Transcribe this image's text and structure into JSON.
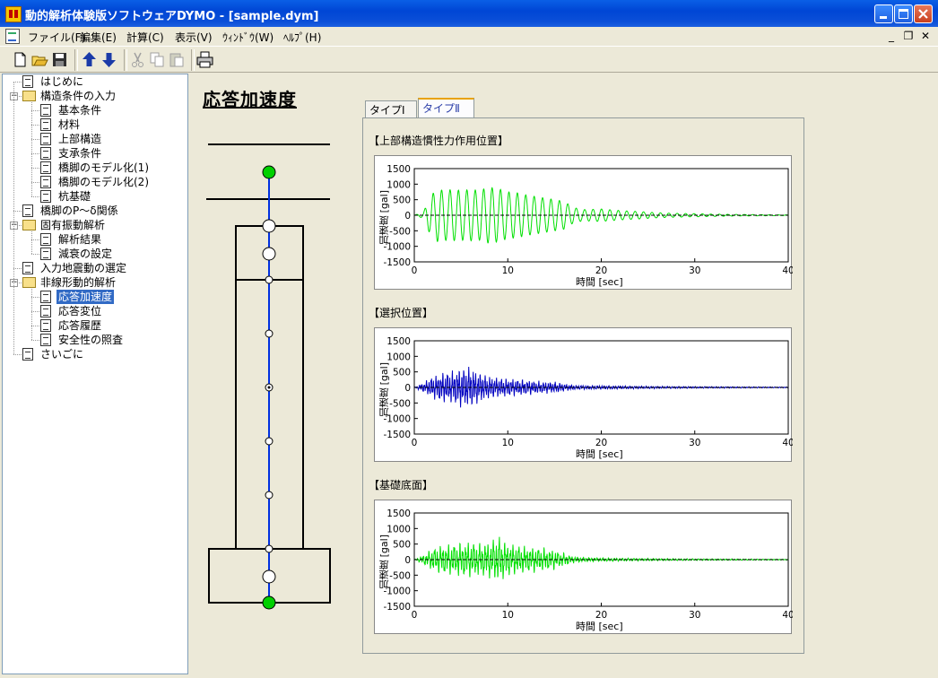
{
  "window": {
    "title": "動的解析体験版ソフトウェアDYMO - [sample.dym]"
  },
  "menu": [
    {
      "label": "ファイル(F)"
    },
    {
      "label": "編集(E)"
    },
    {
      "label": "計算(C)"
    },
    {
      "label": "表示(V)"
    },
    {
      "label": "ｳｨﾝﾄﾞｳ(W)"
    },
    {
      "label": "ﾍﾙﾌﾟ(H)"
    }
  ],
  "toolbar": [
    "new-icon",
    "open-icon",
    "save-icon",
    "arrow-up-icon",
    "arrow-down-icon",
    "cut-icon",
    "copy-icon",
    "paste-icon",
    "print-icon"
  ],
  "tree": [
    {
      "label": "はじめに",
      "level": 0,
      "type": "doc"
    },
    {
      "label": "構造条件の入力",
      "level": 0,
      "type": "folder"
    },
    {
      "label": "基本条件",
      "level": 1,
      "type": "doc"
    },
    {
      "label": "材料",
      "level": 1,
      "type": "doc"
    },
    {
      "label": "上部構造",
      "level": 1,
      "type": "doc"
    },
    {
      "label": "支承条件",
      "level": 1,
      "type": "doc"
    },
    {
      "label": "橋脚のモデル化(1)",
      "level": 1,
      "type": "doc"
    },
    {
      "label": "橋脚のモデル化(2)",
      "level": 1,
      "type": "doc"
    },
    {
      "label": "杭基礎",
      "level": 1,
      "type": "doc"
    },
    {
      "label": "橋脚のP～δ関係",
      "level": 0,
      "type": "doc"
    },
    {
      "label": "固有振動解析",
      "level": 0,
      "type": "folder"
    },
    {
      "label": "解析結果",
      "level": 1,
      "type": "doc"
    },
    {
      "label": "減衰の設定",
      "level": 1,
      "type": "doc"
    },
    {
      "label": "入力地震動の選定",
      "level": 0,
      "type": "doc"
    },
    {
      "label": "非線形動的解析",
      "level": 0,
      "type": "folder"
    },
    {
      "label": "応答加速度",
      "level": 1,
      "type": "doc",
      "selected": true
    },
    {
      "label": "応答変位",
      "level": 1,
      "type": "doc"
    },
    {
      "label": "応答履歴",
      "level": 1,
      "type": "doc"
    },
    {
      "label": "安全性の照査",
      "level": 1,
      "type": "doc"
    },
    {
      "label": "さいごに",
      "level": 0,
      "type": "doc"
    }
  ],
  "page": {
    "title": "応答加速度"
  },
  "tabs": [
    {
      "label": "タイプⅠ",
      "active": false
    },
    {
      "label": "タイプⅡ",
      "active": true
    }
  ],
  "colors": {
    "green_series": "#00e000",
    "blue_series": "#0000c0",
    "node_green": "#00d000",
    "beam_blue": "#0030e0"
  },
  "charts": [
    {
      "title": "【上部構造慣性力作用位置】",
      "chart_data": {
        "type": "line",
        "x_range": [
          0,
          40
        ],
        "y_range": [
          -1500,
          1500
        ],
        "xticks": [
          "0",
          "10",
          "20",
          "30",
          "40"
        ],
        "yticks": [
          "1500",
          "1000",
          "500",
          "0",
          "-500",
          "-1000",
          "-1500"
        ],
        "xlabel": "時間 [sec]",
        "ylabel": "加速度 [gal]",
        "color": "#00e000",
        "envelope": [
          [
            0,
            0
          ],
          [
            1,
            100
          ],
          [
            1.5,
            500
          ],
          [
            2,
            700
          ],
          [
            2.5,
            850
          ],
          [
            3,
            800
          ],
          [
            4,
            820
          ],
          [
            5,
            800
          ],
          [
            6,
            820
          ],
          [
            7,
            800
          ],
          [
            8,
            900
          ],
          [
            9,
            850
          ],
          [
            10,
            750
          ],
          [
            11,
            720
          ],
          [
            12,
            650
          ],
          [
            13,
            600
          ],
          [
            14,
            550
          ],
          [
            15,
            500
          ],
          [
            16,
            450
          ],
          [
            17,
            250
          ],
          [
            18,
            180
          ],
          [
            20,
            200
          ],
          [
            22,
            150
          ],
          [
            24,
            120
          ],
          [
            26,
            80
          ],
          [
            28,
            60
          ],
          [
            30,
            50
          ],
          [
            33,
            30
          ],
          [
            36,
            20
          ],
          [
            40,
            10
          ]
        ],
        "period": 0.9
      }
    },
    {
      "title": "【選択位置】",
      "chart_data": {
        "type": "line",
        "x_range": [
          0,
          40
        ],
        "y_range": [
          -1500,
          1500
        ],
        "xticks": [
          "0",
          "10",
          "20",
          "30",
          "40"
        ],
        "yticks": [
          "1500",
          "1000",
          "500",
          "0",
          "-500",
          "-1000",
          "-1500"
        ],
        "xlabel": "時間 [sec]",
        "ylabel": "加速度 [gal]",
        "color": "#0000c0",
        "envelope": [
          [
            0,
            0
          ],
          [
            1,
            150
          ],
          [
            2,
            350
          ],
          [
            3,
            450
          ],
          [
            4,
            500
          ],
          [
            5,
            600
          ],
          [
            6,
            620
          ],
          [
            7,
            450
          ],
          [
            8,
            350
          ],
          [
            9,
            300
          ],
          [
            10,
            280
          ],
          [
            11,
            250
          ],
          [
            12,
            230
          ],
          [
            13,
            200
          ],
          [
            14,
            180
          ],
          [
            15,
            170
          ],
          [
            16,
            120
          ],
          [
            17,
            70
          ],
          [
            18,
            60
          ],
          [
            20,
            55
          ],
          [
            24,
            40
          ],
          [
            28,
            30
          ],
          [
            32,
            25
          ],
          [
            36,
            20
          ],
          [
            40,
            15
          ]
        ],
        "period": 0.25
      }
    },
    {
      "title": "【基礎底面】",
      "chart_data": {
        "type": "line",
        "x_range": [
          0,
          40
        ],
        "y_range": [
          -1500,
          1500
        ],
        "xticks": [
          "0",
          "10",
          "20",
          "30",
          "40"
        ],
        "yticks": [
          "1500",
          "1000",
          "500",
          "0",
          "-500",
          "-1000",
          "-1500"
        ],
        "xlabel": "時間 [sec]",
        "ylabel": "加速度 [gal]",
        "color": "#00e000",
        "envelope": [
          [
            0,
            0
          ],
          [
            1,
            150
          ],
          [
            2,
            350
          ],
          [
            3,
            450
          ],
          [
            4,
            480
          ],
          [
            5,
            520
          ],
          [
            6,
            550
          ],
          [
            7,
            500
          ],
          [
            8,
            560
          ],
          [
            9,
            720
          ],
          [
            10,
            500
          ],
          [
            11,
            450
          ],
          [
            12,
            400
          ],
          [
            13,
            380
          ],
          [
            14,
            350
          ],
          [
            15,
            300
          ],
          [
            16,
            200
          ],
          [
            17,
            100
          ],
          [
            18,
            70
          ],
          [
            20,
            55
          ],
          [
            24,
            40
          ],
          [
            28,
            30
          ],
          [
            32,
            25
          ],
          [
            36,
            20
          ],
          [
            40,
            15
          ]
        ],
        "period": 0.3
      }
    }
  ]
}
